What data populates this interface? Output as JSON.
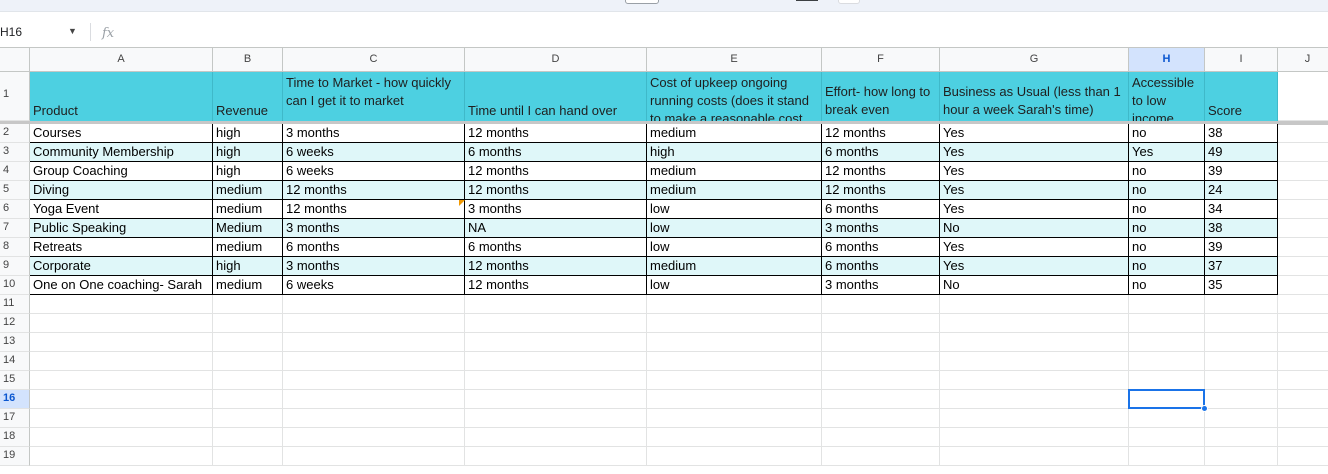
{
  "formula_bar": {
    "cell_reference": "H16",
    "fx_label": "fx"
  },
  "columns": [
    "A",
    "B",
    "C",
    "D",
    "E",
    "F",
    "G",
    "H",
    "I",
    "J"
  ],
  "selected_column": "H",
  "headers": {
    "product": "Product",
    "revenue": "Revenue",
    "time_to_market": "Time to Market - how quickly can I get it to market",
    "handover": "Time until I can hand over",
    "upkeep": "Cost of upkeep ongoing running costs (does it stand to make a reasonable cost",
    "effort": "Effort- how long to break even",
    "bau": "Business as Usual (less than 1 hour a week Sarah's time)",
    "accessible": "Accessible to low income",
    "score": "Score"
  },
  "rows": [
    {
      "product": "Courses",
      "revenue": "high",
      "market": "3 months",
      "handover": "12 months",
      "upkeep": "medium",
      "effort": "12 months",
      "bau": "Yes",
      "accessible": "no",
      "score": "38"
    },
    {
      "product": "Community Membership",
      "revenue": "high",
      "market": "6 weeks",
      "handover": "6 months",
      "upkeep": "high",
      "effort": "6 months",
      "bau": "Yes",
      "accessible": "Yes",
      "score": "49"
    },
    {
      "product": "Group Coaching",
      "revenue": "high",
      "market": "6 weeks",
      "handover": "12 months",
      "upkeep": "medium",
      "effort": "12 months",
      "bau": "Yes",
      "accessible": "no",
      "score": "39"
    },
    {
      "product": "Diving",
      "revenue": "medium",
      "market": "12 months",
      "handover": "12 months",
      "upkeep": "medium",
      "effort": "12 months",
      "bau": "Yes",
      "accessible": "no",
      "score": "24"
    },
    {
      "product": "Yoga Event",
      "revenue": "medium",
      "market": "12 months",
      "handover": "3 months",
      "upkeep": "low",
      "effort": "6 months",
      "bau": "Yes",
      "accessible": "no",
      "score": "34"
    },
    {
      "product": "Public Speaking",
      "revenue": "Medium",
      "market": "3 months",
      "handover": "NA",
      "upkeep": "low",
      "effort": "3 months",
      "bau": "No",
      "accessible": "no",
      "score": "38"
    },
    {
      "product": "Retreats",
      "revenue": "medium",
      "market": "6 months",
      "handover": "6 months",
      "upkeep": "low",
      "effort": "6 months",
      "bau": "Yes",
      "accessible": "no",
      "score": "39"
    },
    {
      "product": "Corporate",
      "revenue": "high",
      "market": "3 months",
      "handover": "12 months",
      "upkeep": "medium",
      "effort": "6 months",
      "bau": "Yes",
      "accessible": "no",
      "score": "37"
    },
    {
      "product": "One on One coaching- Sarah",
      "revenue": "medium",
      "market": "6 weeks",
      "handover": "12 months",
      "upkeep": "low",
      "effort": "3 months",
      "bau": "No",
      "accessible": "no",
      "score": "35"
    }
  ],
  "row_numbers": [
    "1",
    "2",
    "3",
    "4",
    "5",
    "6",
    "7",
    "8",
    "9",
    "10",
    "11",
    "12",
    "13",
    "14",
    "15",
    "16",
    "17",
    "18",
    "19"
  ],
  "selected_row": "16",
  "colors": {
    "header_fill": "#4dd0e1",
    "band_fill": "#dff7f9",
    "selection": "#1a73e8"
  }
}
